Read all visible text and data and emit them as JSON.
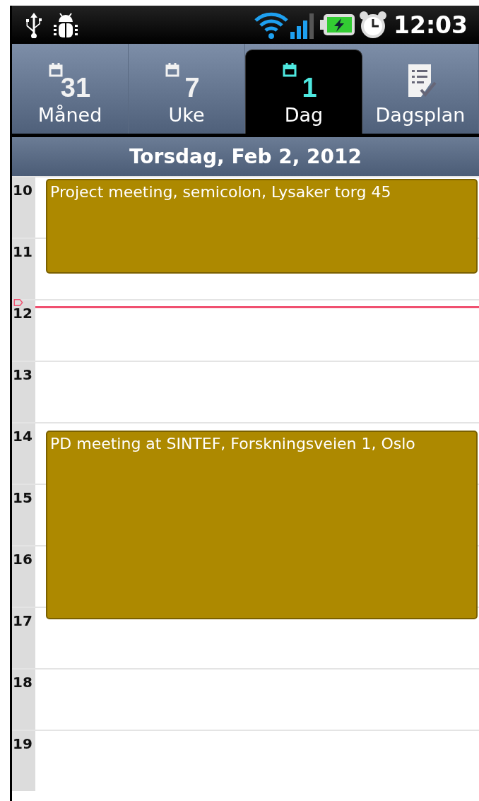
{
  "status_bar": {
    "time": "12:03"
  },
  "tabs": [
    {
      "label": "Måned",
      "kind": "calendar",
      "icon_text": "31",
      "selected": false
    },
    {
      "label": "Uke",
      "kind": "calendar",
      "icon_text": "7",
      "selected": false
    },
    {
      "label": "Dag",
      "kind": "calendar",
      "icon_text": "1",
      "selected": true
    },
    {
      "label": "Dagsplan",
      "kind": "checklist",
      "selected": false
    }
  ],
  "date_header": "Torsdag, Feb 2, 2012",
  "hours": [
    "10",
    "11",
    "12",
    "13",
    "14",
    "15",
    "16",
    "17",
    "18",
    "19"
  ],
  "events": [
    {
      "title": "Project meeting, semicolon, Lysaker torg 45",
      "color": "#ad8900"
    },
    {
      "title": "PD meeting at SINTEF, Forskningsveien 1, Oslo",
      "color": "#ad8900"
    }
  ]
}
